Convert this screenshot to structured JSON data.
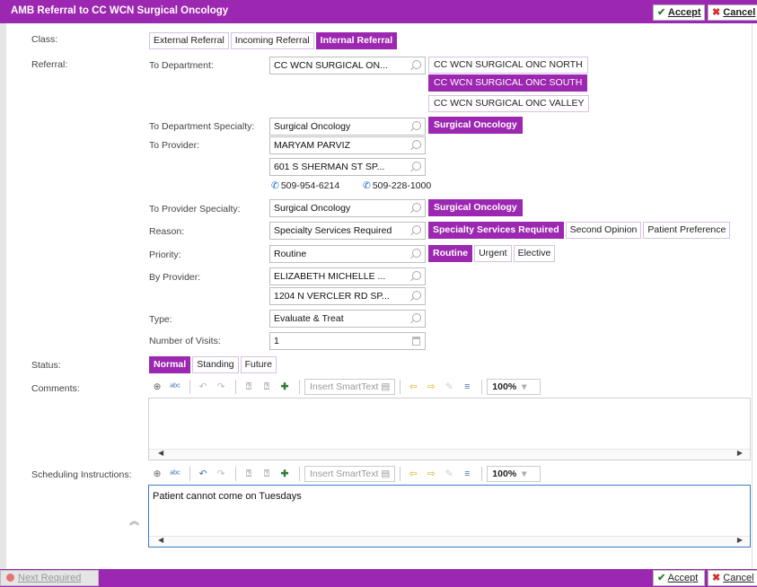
{
  "window": {
    "title": "AMB Referral to CC WCN Surgical Oncology",
    "accept_label": "Accept",
    "cancel_label": "Cancel"
  },
  "class": {
    "label": "Class:",
    "options": [
      "External Referral",
      "Incoming Referral",
      "Internal Referral"
    ],
    "selected": "Internal Referral"
  },
  "referral": {
    "label": "Referral:",
    "to_department": {
      "label": "To Department:",
      "value": "CC WCN SURGICAL ON...",
      "suggestions": [
        "CC WCN SURGICAL ONC NORTH",
        "CC WCN SURGICAL ONC SOUTH",
        "CC WCN SURGICAL ONC VALLEY"
      ],
      "selected": "CC WCN SURGICAL ONC SOUTH"
    },
    "to_department_specialty": {
      "label": "To Department Specialty:",
      "value": "Surgical Oncology",
      "chip": "Surgical Oncology"
    },
    "to_provider": {
      "label": "To Provider:",
      "value": "MARYAM PARVIZ",
      "address": "601 S SHERMAN ST SP...",
      "phone1": "509-954-6214",
      "phone2": "509-228-1000"
    },
    "to_provider_specialty": {
      "label": "To Provider Specialty:",
      "value": "Surgical Oncology",
      "chip": "Surgical Oncology"
    },
    "reason": {
      "label": "Reason:",
      "value": "Specialty Services Required",
      "options": [
        "Specialty Services Required",
        "Second Opinion",
        "Patient Preference"
      ],
      "selected": "Specialty Services Required"
    },
    "priority": {
      "label": "Priority:",
      "value": "Routine",
      "options": [
        "Routine",
        "Urgent",
        "Elective"
      ],
      "selected": "Routine"
    },
    "by_provider": {
      "label": "By Provider:",
      "value": "ELIZABETH MICHELLE ...",
      "address": "1204 N VERCLER RD SP..."
    },
    "type": {
      "label": "Type:",
      "value": "Evaluate & Treat"
    },
    "visits": {
      "label": "Number of Visits:",
      "value": "1"
    }
  },
  "status": {
    "label": "Status:",
    "options": [
      "Normal",
      "Standing",
      "Future"
    ],
    "selected": "Normal"
  },
  "comments": {
    "label": "Comments:",
    "text": ""
  },
  "scheduling": {
    "label": "Scheduling Instructions:",
    "text": "Patient cannot come on Tuesdays"
  },
  "toolbar": {
    "insert_smarttext": "Insert SmartText",
    "zoom": "100%"
  },
  "footer": {
    "next_required": "Next Required"
  },
  "colors": {
    "accent": "#9c27b0",
    "focus": "#3b7dc4"
  }
}
